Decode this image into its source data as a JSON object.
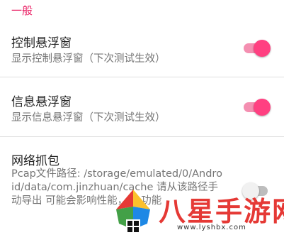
{
  "section": {
    "title": "一般"
  },
  "settings": [
    {
      "title": "控制悬浮窗",
      "summary": "显示控制悬浮窗（下次测试生效）",
      "enabled": true
    },
    {
      "title": "信息悬浮窗",
      "summary": "显示信息悬浮窗（下次测试生效）",
      "enabled": true
    },
    {
      "title": "网络抓包",
      "summary": "Pcap文件路径: /storage/emulated/0/Android/data/com.jinzhuan/cache 请从该路径手动导出 可能会影响性能，如 功能",
      "enabled": false
    }
  ],
  "watermark": {
    "text": "八星手游网",
    "url": "www.lyshbx.com"
  },
  "colors": {
    "accent": "#ff4081",
    "accent_track": "#f48fb1",
    "section_header": "#e91e63",
    "watermark_red": "#e53935"
  }
}
